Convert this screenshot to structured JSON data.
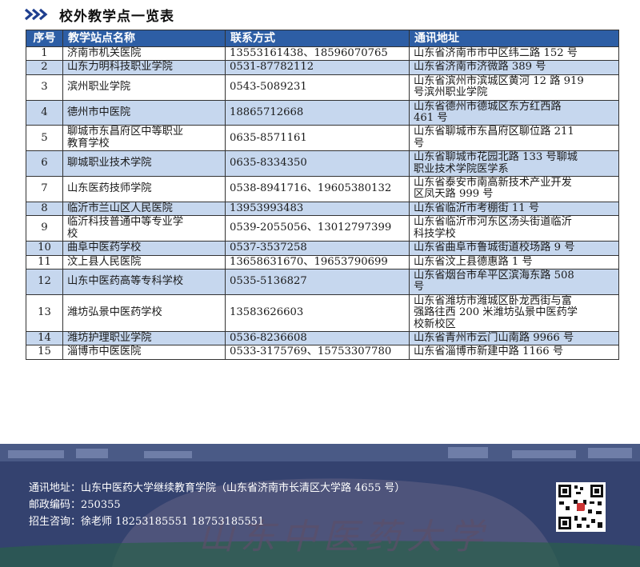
{
  "header": {
    "title": "校外教学点一览表"
  },
  "table": {
    "columns": [
      "序号",
      "教学站点名称",
      "联系方式",
      "通讯地址"
    ],
    "rows": [
      {
        "no": "1",
        "name": "济南市机关医院",
        "contact": "13553161438、18596070765",
        "address": "山东省济南市市中区纬二路 152 号"
      },
      {
        "no": "2",
        "name": "山东力明科技职业学院",
        "contact": "0531-87782112",
        "address": "山东省济南市济微路 389 号"
      },
      {
        "no": "3",
        "name": "滨州职业学院",
        "contact": "0543-5089231",
        "address": "山东省滨州市滨城区黄河 12 路 919\n号滨州职业学院"
      },
      {
        "no": "4",
        "name": "德州市中医院",
        "contact": "18865712668",
        "address": "山东省德州市德城区东方红西路\n461 号"
      },
      {
        "no": "5",
        "name": "聊城市东昌府区中等职业\n教育学校",
        "contact": "0635-8571161",
        "address": "山东省聊城市东昌府区聊位路 211\n号"
      },
      {
        "no": "6",
        "name": "聊城职业技术学院",
        "contact": "0635-8334350",
        "address": "山东省聊城市花园北路 133 号聊城\n职业技术学院医学系"
      },
      {
        "no": "7",
        "name": "山东医药技师学院",
        "contact": "0538-8941716、19605380132",
        "address": "山东省泰安市南高新技术产业开发\n区凤天路 999 号"
      },
      {
        "no": "8",
        "name": "临沂市兰山区人民医院",
        "contact": "13953993483",
        "address": "山东省临沂市考棚街 11 号"
      },
      {
        "no": "9",
        "name": "临沂科技普通中等专业学\n校",
        "contact": "0539-2055056、13012797399",
        "address": "山东省临沂市河东区汤头街道临沂\n科技学校"
      },
      {
        "no": "10",
        "name": "曲阜中医药学校",
        "contact": "0537-3537258",
        "address": "山东省曲阜市鲁城街道校场路 9 号"
      },
      {
        "no": "11",
        "name": "汶上县人民医院",
        "contact": "13658631670、19653790699",
        "address": "山东省汶上县德惠路 1 号"
      },
      {
        "no": "12",
        "name": "山东中医药高等专科学校",
        "contact": "0535-5136827",
        "address": "山东省烟台市牟平区滨海东路 508\n号"
      },
      {
        "no": "13",
        "name": "潍坊弘景中医药学校",
        "contact": "13583626603",
        "address": "山东省潍坊市潍城区卧龙西街与富\n强路往西 200 米潍坊弘景中医药学\n校新校区"
      },
      {
        "no": "14",
        "name": "潍坊护理职业学院",
        "contact": "0536-8236608",
        "address": "山东省青州市云门山南路 9966 号"
      },
      {
        "no": "15",
        "name": "淄博市中医医院",
        "contact": "0533-3175769、15753307780",
        "address": "山东省淄博市新建中路 1166 号"
      }
    ]
  },
  "footer": {
    "address_line": "通讯地址：山东中医药大学继续教育学院（山东省济南市长清区大学路 4655 号）",
    "postcode_line": "邮政编码：250355",
    "consult_line": "招生咨询：徐老师 18253185551 18753185551",
    "watermark": "山东中医药大学"
  },
  "colors": {
    "header_bg": "#2d5ea5",
    "alt_row": "#c6d7ee",
    "footer_bg": "#2f3b6a"
  }
}
